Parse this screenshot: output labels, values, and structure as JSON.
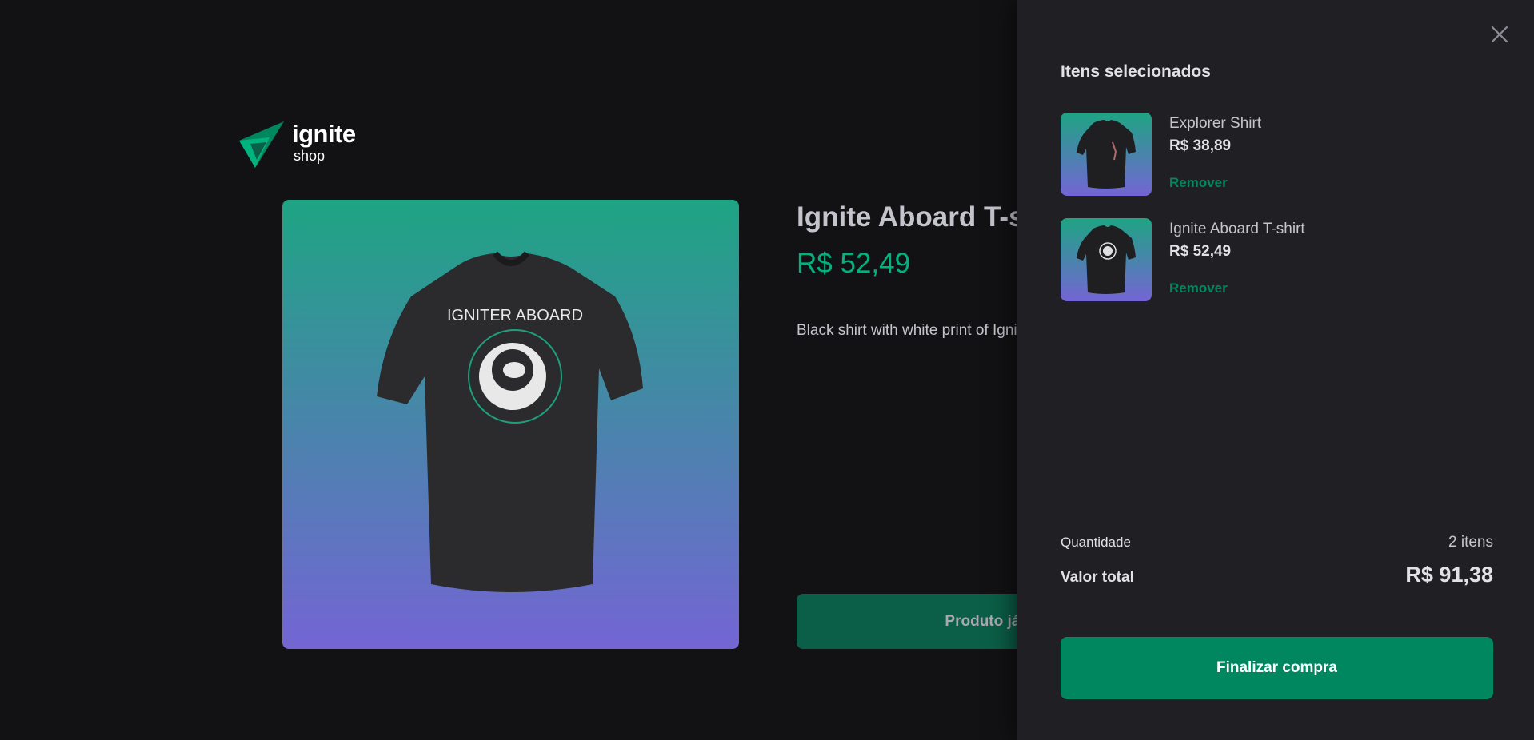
{
  "header": {
    "logo_title": "ignite",
    "logo_subtitle": "shop",
    "logo_icon": "ignite-logo-icon"
  },
  "product": {
    "title": "Ignite Aboard T-shirt",
    "price": "R$ 52,49",
    "description": "Black shirt with white print of Ignite Aboard",
    "button_label": "Produto já está na sacola",
    "image_icon": "tshirt-icon"
  },
  "cart": {
    "title": "Itens selecionados",
    "close_icon": "close-icon",
    "items": [
      {
        "name": "Explorer Shirt",
        "price": "R$ 38,89",
        "remove_label": "Remover"
      },
      {
        "name": "Ignite Aboard T-shirt",
        "price": "R$ 52,49",
        "remove_label": "Remover"
      }
    ],
    "quantity_label": "Quantidade",
    "quantity_value": "2 itens",
    "total_label": "Valor total",
    "total_value": "R$ 91,38",
    "checkout_label": "Finalizar compra"
  },
  "colors": {
    "background": "#121214",
    "panel": "#202024",
    "accent": "#00875f",
    "accent_light": "#00b37e",
    "gradient_top": "#1ea483",
    "gradient_bottom": "#7465d4"
  }
}
